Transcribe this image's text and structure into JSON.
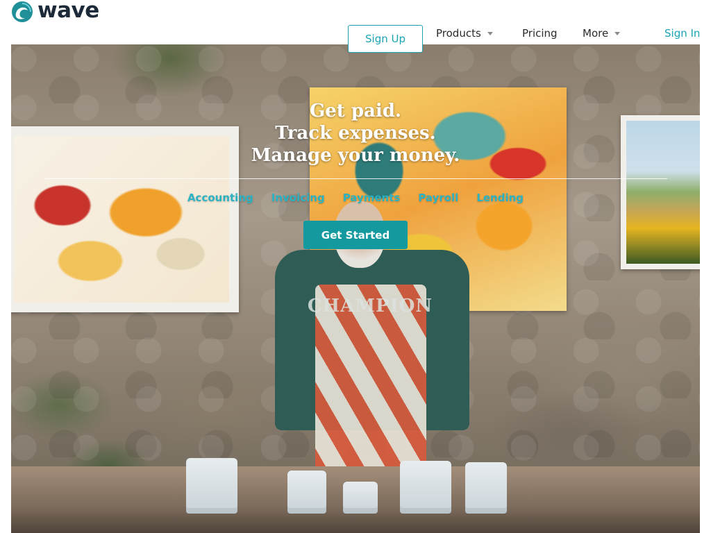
{
  "brand": {
    "name": "wave",
    "logo_icon": "wave-swirl-icon",
    "accent_color": "#1aa4b4",
    "cta_color": "#14999f"
  },
  "nav": {
    "signup_label": "Sign Up",
    "products_label": "Products",
    "pricing_label": "Pricing",
    "more_label": "More",
    "signin_label": "Sign In"
  },
  "hero": {
    "headline_lines": [
      "Get paid.",
      "Track expenses.",
      "Manage your money."
    ],
    "product_links": [
      "Accounting",
      "Invoicing",
      "Payments",
      "Payroll",
      "Lending"
    ],
    "cta_label": "Get Started",
    "photo_print": "CHAMPION"
  }
}
